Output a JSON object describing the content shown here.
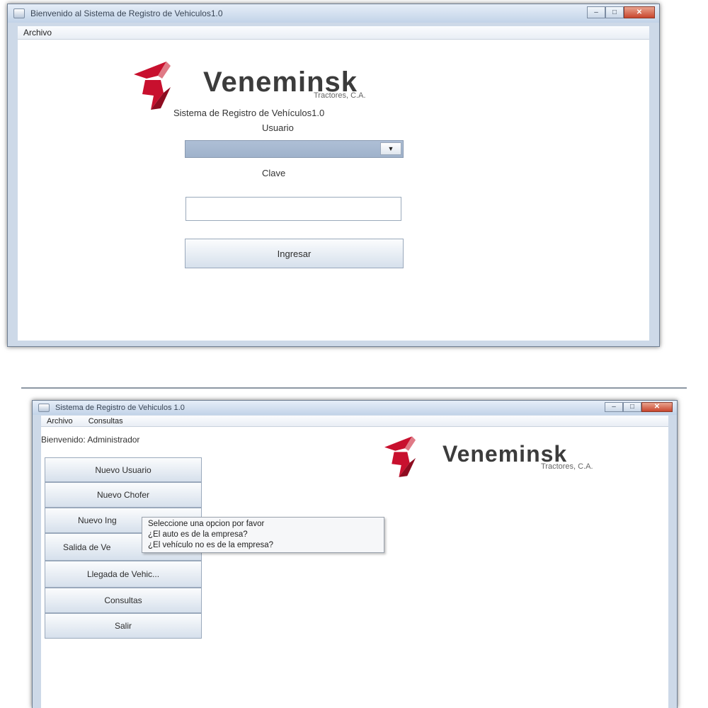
{
  "login_window": {
    "title": "Bienvenido al Sistema de Registro de Vehiculos1.0",
    "controls": {
      "minimize": "–",
      "maximize": "□",
      "close": "✕"
    },
    "menu": [
      "Archivo"
    ],
    "logo": {
      "brand": "Veneminsk",
      "subtitle": "Tractores, C.A."
    },
    "system_name": "Sistema de Registro de Vehículos1.0",
    "user_label": "Usuario",
    "user_select_value": "",
    "password_label": "Clave",
    "password_value": "",
    "login_button": "Ingresar"
  },
  "main_window": {
    "title": "Sistema de Registro de Vehiculos 1.0",
    "controls": {
      "minimize": "–",
      "maximize": "□",
      "close": "✕"
    },
    "menu": [
      "Archivo",
      "Consultas"
    ],
    "welcome": "Bienvenido: Administrador",
    "logo": {
      "brand": "Veneminsk",
      "subtitle": "Tractores, C.A."
    },
    "buttons": [
      "Nuevo Usuario",
      "Nuevo Chofer",
      "Nuevo Ing",
      "Salida de Ve",
      "Llegada de Vehic...",
      "Consultas",
      "Salir"
    ],
    "popup_items": [
      "Seleccione una opcion por favor",
      "¿El auto es de la empresa?",
      "¿El vehículo no es de la empresa?"
    ]
  },
  "colors": {
    "brand_red": "#c8102e",
    "title_gradient_top": "#e6eef8",
    "close_button": "#c8452d"
  }
}
